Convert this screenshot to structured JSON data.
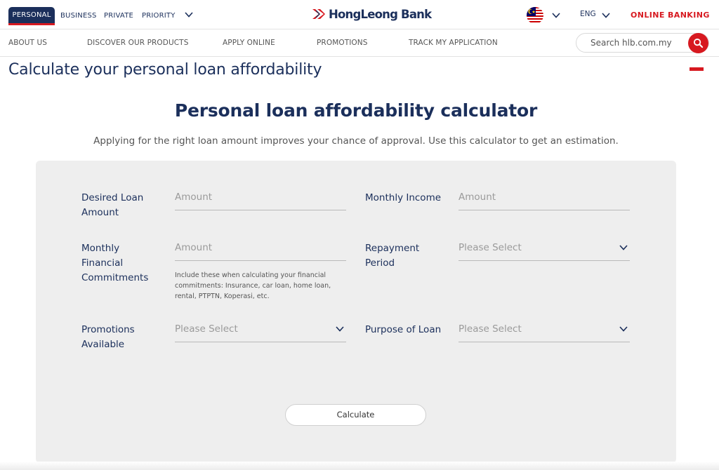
{
  "topbar": {
    "segments": [
      "PERSONAL",
      "BUSINESS",
      "PRIVATE",
      "PRIORITY"
    ],
    "logo_text": "HongLeong Bank",
    "language": "ENG",
    "online_banking": "ONLINE BANKING"
  },
  "nav": {
    "items": [
      "ABOUT US",
      "DISCOVER OUR PRODUCTS",
      "APPLY ONLINE",
      "PROMOTIONS",
      "TRACK MY APPLICATION"
    ],
    "search_placeholder": "Search hlb.com.my"
  },
  "page": {
    "title": "Calculate your personal loan affordability",
    "calculator_title": "Personal loan affordability calculator",
    "calculator_subtitle": "Applying for the right loan amount improves your chance of approval. Use this calculator to get an estimation."
  },
  "form": {
    "desired_loan": {
      "label": "Desired Loan Amount",
      "placeholder": "Amount"
    },
    "monthly_income": {
      "label": "Monthly Income",
      "placeholder": "Amount"
    },
    "commitments": {
      "label": "Monthly Financial Commitments",
      "placeholder": "Amount",
      "hint": "Include these when calculating your financial commitments: Insurance, car loan, home loan, rental, PTPTN, Koperasi, etc."
    },
    "repayment": {
      "label": "Repayment Period",
      "placeholder": "Please Select"
    },
    "promotions": {
      "label": "Promotions Available",
      "placeholder": "Please Select"
    },
    "purpose": {
      "label": "Purpose of Loan",
      "placeholder": "Please Select"
    },
    "calculate_label": "Calculate"
  },
  "colors": {
    "navy": "#1b2f5b",
    "red": "#d71920",
    "panel": "#eeeeee"
  }
}
